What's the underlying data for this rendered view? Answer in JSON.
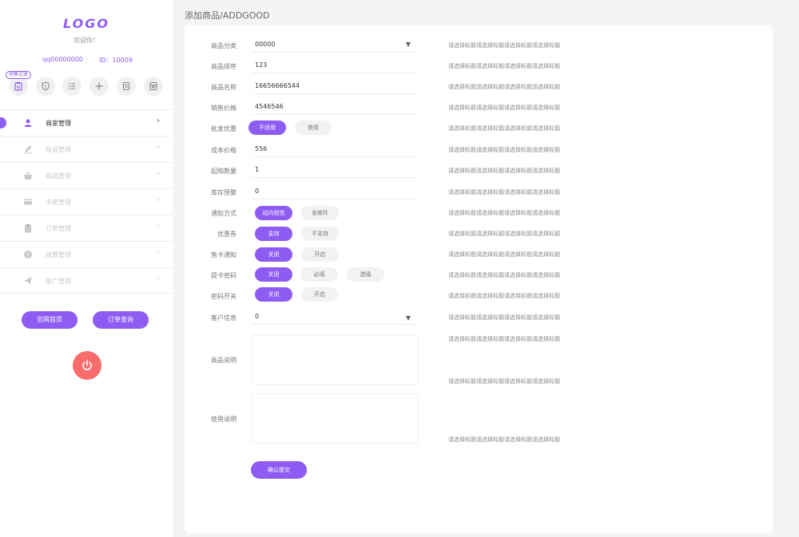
{
  "sidebar": {
    "logo": "LOGO",
    "welcome": "欢迎你！",
    "qq": "qq00000000",
    "id": "ID：10009",
    "quick_tag": "销售记录",
    "quick_icons": [
      "clipboard-icon",
      "shield-alert-icon",
      "list-icon",
      "plus-icon",
      "document-icon",
      "archive-icon"
    ],
    "nav": [
      {
        "label": "商家管理",
        "icon": "user-icon",
        "active": true
      },
      {
        "label": "投诉管理",
        "icon": "pencil-icon",
        "active": false
      },
      {
        "label": "商品管理",
        "icon": "basket-icon",
        "active": false
      },
      {
        "label": "卡密管理",
        "icon": "card-icon",
        "active": false
      },
      {
        "label": "订单管理",
        "icon": "clipboard-icon",
        "active": false
      },
      {
        "label": "结算管理",
        "icon": "coin-icon",
        "active": false
      },
      {
        "label": "推广管理",
        "icon": "paper-plane-icon",
        "active": false
      }
    ],
    "home_button": "官网首页",
    "order_button": "订单查询",
    "accent": "#8e5cf3",
    "power_color": "#f76c6c"
  },
  "page_title": "添加商品/ADDGOOD",
  "form": {
    "category_label": "商品分类",
    "category_value": "00000",
    "sort_label": "商品排序",
    "sort_value": "123",
    "name_label": "商品名称",
    "name_value": "16656666544",
    "price_label": "销售价格",
    "price_value": "4546546",
    "wholesale_label": "批发优惠",
    "wholesale_on": "不适用",
    "wholesale_off": "使用",
    "cost_label": "成本价格",
    "cost_value": "556",
    "min_label": "起购数量",
    "min_value": "1",
    "stock_label": "库存预警",
    "stock_value": "0",
    "notify_label": "通知方式",
    "notify_on": "站内短信",
    "notify_off": "发邮件",
    "coupon_label": "优惠券",
    "coupon_on": "支持",
    "coupon_off": "不支持",
    "sell_notify_label": "售卡通知",
    "sell_notify_on": "关闭",
    "sell_notify_off": "开启",
    "pickup_label": "提卡密码",
    "pickup_on": "关闭",
    "pickup_mid": "必填",
    "pickup_off": "选填",
    "pw_label": "密码开关",
    "pw_on": "关闭",
    "pw_off": "开启",
    "customer_label": "客户信息",
    "customer_value": "0",
    "desc_label": "商品说明",
    "usage_label": "使用说明",
    "submit": "确认提交",
    "hint": "请选择标题请选择标题请选择标题请选择标题"
  }
}
